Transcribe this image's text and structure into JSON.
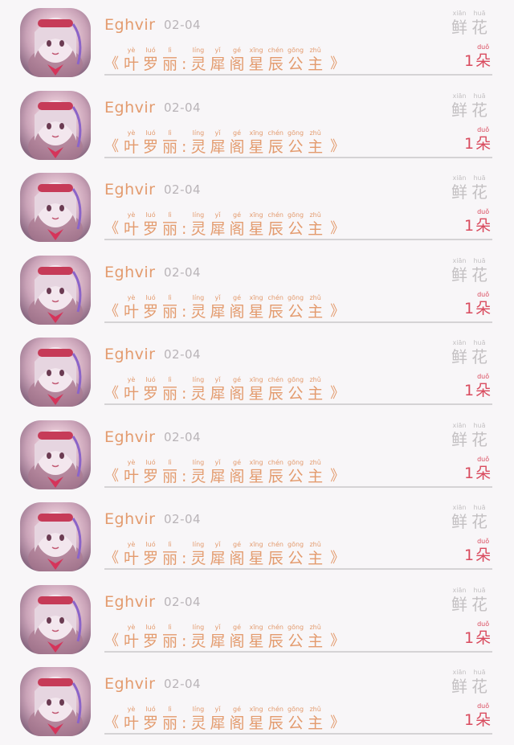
{
  "items": [
    {
      "username": "Eghvir",
      "date": "02-04",
      "open": "《",
      "close": "》",
      "title": [
        {
          "py": "yè",
          "hz": "叶"
        },
        {
          "py": "luó",
          "hz": "罗"
        },
        {
          "py": "lì",
          "hz": "丽"
        },
        {
          "py": "",
          "hz": ":"
        },
        {
          "py": "líng",
          "hz": "灵"
        },
        {
          "py": "yǐ",
          "hz": "犀"
        },
        {
          "py": "gé",
          "hz": "阁"
        },
        {
          "py": "xīng",
          "hz": "星"
        },
        {
          "py": "chén",
          "hz": "辰"
        },
        {
          "py": "gōng",
          "hz": "公"
        },
        {
          "py": "zhǔ",
          "hz": "主"
        }
      ],
      "gift": [
        {
          "py": "xiān",
          "hz": "鲜"
        },
        {
          "py": "huā",
          "hz": "花"
        }
      ],
      "count": "1",
      "unit": {
        "py": "duǒ",
        "hz": "朵"
      }
    },
    {
      "username": "Eghvir",
      "date": "02-04",
      "open": "《",
      "close": "》",
      "title": [
        {
          "py": "yè",
          "hz": "叶"
        },
        {
          "py": "luó",
          "hz": "罗"
        },
        {
          "py": "lì",
          "hz": "丽"
        },
        {
          "py": "",
          "hz": ":"
        },
        {
          "py": "líng",
          "hz": "灵"
        },
        {
          "py": "yǐ",
          "hz": "犀"
        },
        {
          "py": "gé",
          "hz": "阁"
        },
        {
          "py": "xīng",
          "hz": "星"
        },
        {
          "py": "chén",
          "hz": "辰"
        },
        {
          "py": "gōng",
          "hz": "公"
        },
        {
          "py": "zhǔ",
          "hz": "主"
        }
      ],
      "gift": [
        {
          "py": "xiān",
          "hz": "鲜"
        },
        {
          "py": "huā",
          "hz": "花"
        }
      ],
      "count": "1",
      "unit": {
        "py": "duǒ",
        "hz": "朵"
      }
    },
    {
      "username": "Eghvir",
      "date": "02-04",
      "open": "《",
      "close": "》",
      "title": [
        {
          "py": "yè",
          "hz": "叶"
        },
        {
          "py": "luó",
          "hz": "罗"
        },
        {
          "py": "lì",
          "hz": "丽"
        },
        {
          "py": "",
          "hz": ":"
        },
        {
          "py": "líng",
          "hz": "灵"
        },
        {
          "py": "yǐ",
          "hz": "犀"
        },
        {
          "py": "gé",
          "hz": "阁"
        },
        {
          "py": "xīng",
          "hz": "星"
        },
        {
          "py": "chén",
          "hz": "辰"
        },
        {
          "py": "gōng",
          "hz": "公"
        },
        {
          "py": "zhǔ",
          "hz": "主"
        }
      ],
      "gift": [
        {
          "py": "xiān",
          "hz": "鲜"
        },
        {
          "py": "huā",
          "hz": "花"
        }
      ],
      "count": "1",
      "unit": {
        "py": "duǒ",
        "hz": "朵"
      }
    },
    {
      "username": "Eghvir",
      "date": "02-04",
      "open": "《",
      "close": "》",
      "title": [
        {
          "py": "yè",
          "hz": "叶"
        },
        {
          "py": "luó",
          "hz": "罗"
        },
        {
          "py": "lì",
          "hz": "丽"
        },
        {
          "py": "",
          "hz": ":"
        },
        {
          "py": "líng",
          "hz": "灵"
        },
        {
          "py": "yǐ",
          "hz": "犀"
        },
        {
          "py": "gé",
          "hz": "阁"
        },
        {
          "py": "xīng",
          "hz": "星"
        },
        {
          "py": "chén",
          "hz": "辰"
        },
        {
          "py": "gōng",
          "hz": "公"
        },
        {
          "py": "zhǔ",
          "hz": "主"
        }
      ],
      "gift": [
        {
          "py": "xiān",
          "hz": "鲜"
        },
        {
          "py": "huā",
          "hz": "花"
        }
      ],
      "count": "1",
      "unit": {
        "py": "duǒ",
        "hz": "朵"
      }
    },
    {
      "username": "Eghvir",
      "date": "02-04",
      "open": "《",
      "close": "》",
      "title": [
        {
          "py": "yè",
          "hz": "叶"
        },
        {
          "py": "luó",
          "hz": "罗"
        },
        {
          "py": "lì",
          "hz": "丽"
        },
        {
          "py": "",
          "hz": ":"
        },
        {
          "py": "líng",
          "hz": "灵"
        },
        {
          "py": "yǐ",
          "hz": "犀"
        },
        {
          "py": "gé",
          "hz": "阁"
        },
        {
          "py": "xīng",
          "hz": "星"
        },
        {
          "py": "chén",
          "hz": "辰"
        },
        {
          "py": "gōng",
          "hz": "公"
        },
        {
          "py": "zhǔ",
          "hz": "主"
        }
      ],
      "gift": [
        {
          "py": "xiān",
          "hz": "鲜"
        },
        {
          "py": "huā",
          "hz": "花"
        }
      ],
      "count": "1",
      "unit": {
        "py": "duǒ",
        "hz": "朵"
      }
    },
    {
      "username": "Eghvir",
      "date": "02-04",
      "open": "《",
      "close": "》",
      "title": [
        {
          "py": "yè",
          "hz": "叶"
        },
        {
          "py": "luó",
          "hz": "罗"
        },
        {
          "py": "lì",
          "hz": "丽"
        },
        {
          "py": "",
          "hz": ":"
        },
        {
          "py": "líng",
          "hz": "灵"
        },
        {
          "py": "yǐ",
          "hz": "犀"
        },
        {
          "py": "gé",
          "hz": "阁"
        },
        {
          "py": "xīng",
          "hz": "星"
        },
        {
          "py": "chén",
          "hz": "辰"
        },
        {
          "py": "gōng",
          "hz": "公"
        },
        {
          "py": "zhǔ",
          "hz": "主"
        }
      ],
      "gift": [
        {
          "py": "xiān",
          "hz": "鲜"
        },
        {
          "py": "huā",
          "hz": "花"
        }
      ],
      "count": "1",
      "unit": {
        "py": "duǒ",
        "hz": "朵"
      }
    },
    {
      "username": "Eghvir",
      "date": "02-04",
      "open": "《",
      "close": "》",
      "title": [
        {
          "py": "yè",
          "hz": "叶"
        },
        {
          "py": "luó",
          "hz": "罗"
        },
        {
          "py": "lì",
          "hz": "丽"
        },
        {
          "py": "",
          "hz": ":"
        },
        {
          "py": "líng",
          "hz": "灵"
        },
        {
          "py": "yǐ",
          "hz": "犀"
        },
        {
          "py": "gé",
          "hz": "阁"
        },
        {
          "py": "xīng",
          "hz": "星"
        },
        {
          "py": "chén",
          "hz": "辰"
        },
        {
          "py": "gōng",
          "hz": "公"
        },
        {
          "py": "zhǔ",
          "hz": "主"
        }
      ],
      "gift": [
        {
          "py": "xiān",
          "hz": "鲜"
        },
        {
          "py": "huā",
          "hz": "花"
        }
      ],
      "count": "1",
      "unit": {
        "py": "duǒ",
        "hz": "朵"
      }
    },
    {
      "username": "Eghvir",
      "date": "02-04",
      "open": "《",
      "close": "》",
      "title": [
        {
          "py": "yè",
          "hz": "叶"
        },
        {
          "py": "luó",
          "hz": "罗"
        },
        {
          "py": "lì",
          "hz": "丽"
        },
        {
          "py": "",
          "hz": ":"
        },
        {
          "py": "líng",
          "hz": "灵"
        },
        {
          "py": "yǐ",
          "hz": "犀"
        },
        {
          "py": "gé",
          "hz": "阁"
        },
        {
          "py": "xīng",
          "hz": "星"
        },
        {
          "py": "chén",
          "hz": "辰"
        },
        {
          "py": "gōng",
          "hz": "公"
        },
        {
          "py": "zhǔ",
          "hz": "主"
        }
      ],
      "gift": [
        {
          "py": "xiān",
          "hz": "鲜"
        },
        {
          "py": "huā",
          "hz": "花"
        }
      ],
      "count": "1",
      "unit": {
        "py": "duǒ",
        "hz": "朵"
      }
    },
    {
      "username": "Eghvir",
      "date": "02-04",
      "open": "《",
      "close": "》",
      "title": [
        {
          "py": "yè",
          "hz": "叶"
        },
        {
          "py": "luó",
          "hz": "罗"
        },
        {
          "py": "lì",
          "hz": "丽"
        },
        {
          "py": "",
          "hz": ":"
        },
        {
          "py": "líng",
          "hz": "灵"
        },
        {
          "py": "yǐ",
          "hz": "犀"
        },
        {
          "py": "gé",
          "hz": "阁"
        },
        {
          "py": "xīng",
          "hz": "星"
        },
        {
          "py": "chén",
          "hz": "辰"
        },
        {
          "py": "gōng",
          "hz": "公"
        },
        {
          "py": "zhǔ",
          "hz": "主"
        }
      ],
      "gift": [
        {
          "py": "xiān",
          "hz": "鲜"
        },
        {
          "py": "huā",
          "hz": "花"
        }
      ],
      "count": "1",
      "unit": {
        "py": "duǒ",
        "hz": "朵"
      }
    }
  ]
}
